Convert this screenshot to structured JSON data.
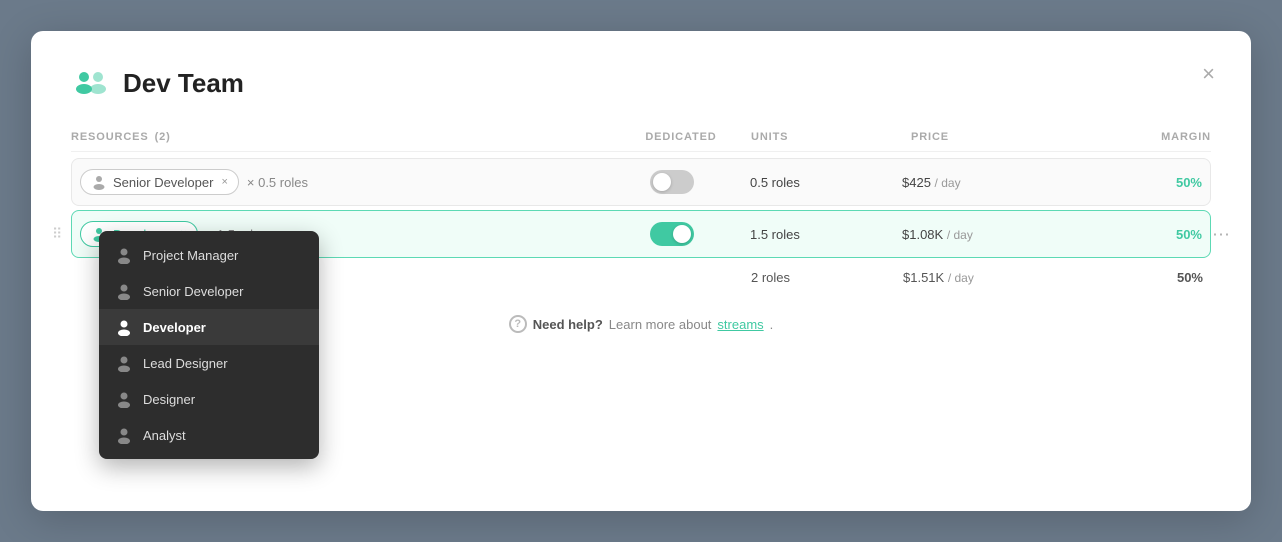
{
  "modal": {
    "title": "Dev Team",
    "close_label": "×"
  },
  "resources_header": {
    "label": "RESOURCES",
    "count": "(2)",
    "cols": {
      "dedicated": "DEDICATED",
      "units": "UNITS",
      "price": "PRICE",
      "margin": "MARGIN"
    }
  },
  "rows": [
    {
      "id": "row-senior-developer",
      "role": "Senior Developer",
      "multiplier": "× 0.5 roles",
      "toggle_state": "off",
      "units": "0.5 roles",
      "price": "$425",
      "price_unit": "/ day",
      "margin": "50%",
      "highlighted": false
    },
    {
      "id": "row-developer",
      "role": "Developer",
      "multiplier": "× 1.5 roles",
      "toggle_state": "on",
      "units": "1.5 roles",
      "price": "$1.08K",
      "price_unit": "/ day",
      "margin": "50%",
      "highlighted": true
    }
  ],
  "totals": {
    "units": "2 roles",
    "price": "$1.51K",
    "price_unit": "/ day",
    "margin": "50%"
  },
  "help": {
    "text": "Need help?",
    "link_text": "streams",
    "suffix": "."
  },
  "dropdown": {
    "items": [
      {
        "label": "Project Manager",
        "selected": false
      },
      {
        "label": "Senior Developer",
        "selected": false
      },
      {
        "label": "Developer",
        "selected": true
      },
      {
        "label": "Lead Designer",
        "selected": false
      },
      {
        "label": "Designer",
        "selected": false
      },
      {
        "label": "Analyst",
        "selected": false
      }
    ]
  }
}
